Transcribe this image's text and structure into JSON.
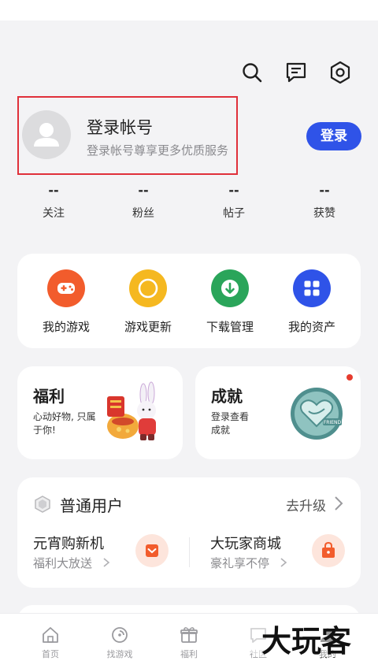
{
  "header": {
    "icons": [
      "search-icon",
      "message-icon",
      "settings-icon"
    ]
  },
  "profile": {
    "title": "登录帐号",
    "subtitle": "登录帐号尊享更多优质服务",
    "login_label": "登录"
  },
  "stats": [
    {
      "value": "--",
      "label": "关注"
    },
    {
      "value": "--",
      "label": "粉丝"
    },
    {
      "value": "--",
      "label": "帖子"
    },
    {
      "value": "--",
      "label": "获赞"
    }
  ],
  "quick_actions": [
    {
      "label": "我的游戏",
      "icon": "gamepad-icon",
      "color": "#f25c2c"
    },
    {
      "label": "游戏更新",
      "icon": "refresh-icon",
      "color": "#f5b820"
    },
    {
      "label": "下载管理",
      "icon": "download-icon",
      "color": "#2aa55a"
    },
    {
      "label": "我的资产",
      "icon": "grid-icon",
      "color": "#2f53e8"
    }
  ],
  "features": {
    "welfare": {
      "title": "福利",
      "subtitle": "心动好物, 只属于你!"
    },
    "achievement": {
      "title": "成就",
      "subtitle": "登录查看 成就",
      "badge_text": "FRIEND"
    }
  },
  "member": {
    "title": "普通用户",
    "upgrade_label": "去升级",
    "promos": [
      {
        "title": "元宵购新机",
        "subtitle": "福利大放送"
      },
      {
        "title": "大玩家商城",
        "subtitle": "豪礼享不停"
      }
    ]
  },
  "tabbar": {
    "active": "我的",
    "tabs": [
      {
        "label": "首页",
        "icon": "home-icon"
      },
      {
        "label": "找游戏",
        "icon": "discover-icon"
      },
      {
        "label": "福利",
        "icon": "gift-icon"
      },
      {
        "label": "社区",
        "icon": "community-icon"
      },
      {
        "label": "我的",
        "icon": "profile-icon"
      }
    ]
  },
  "watermark_text": "大玩客",
  "colors": {
    "accent": "#2f53e8",
    "highlight_border": "#e0303a",
    "badge_dot": "#e63b2e"
  }
}
